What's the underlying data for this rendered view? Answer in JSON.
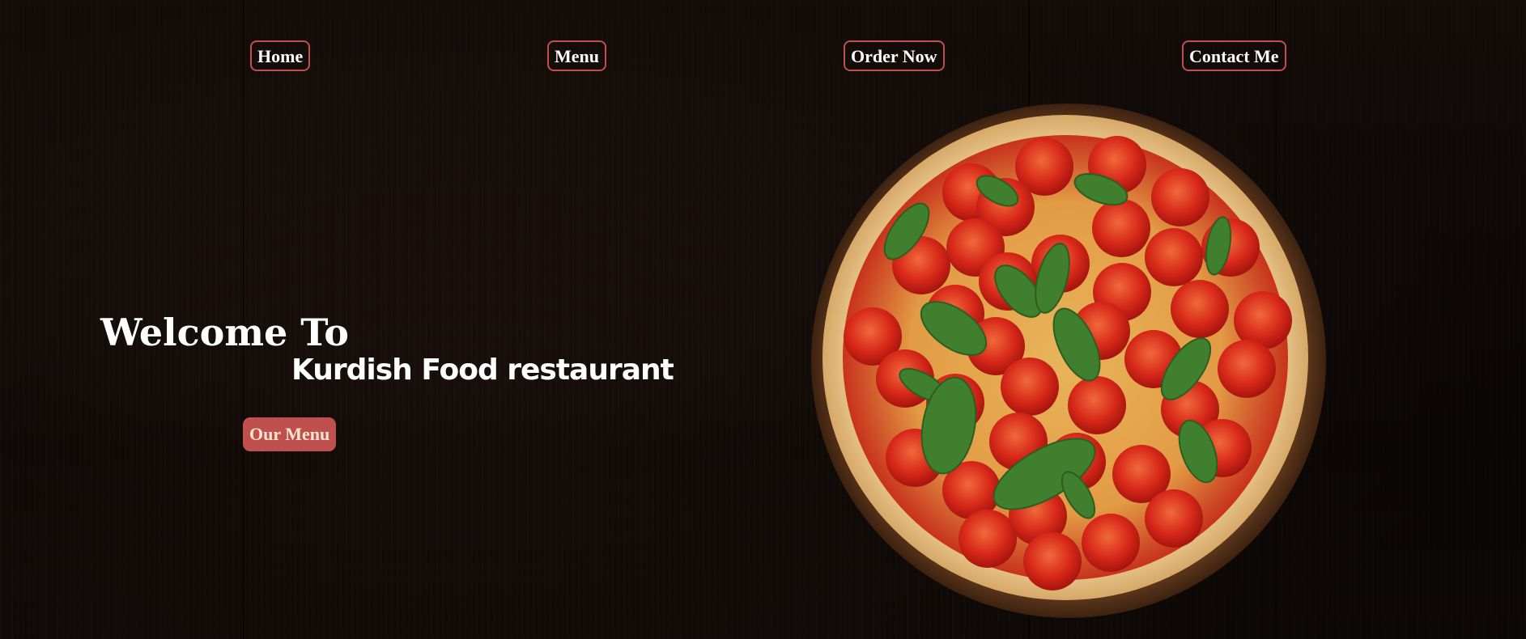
{
  "nav": {
    "items": [
      {
        "label": "Home"
      },
      {
        "label": "Menu"
      },
      {
        "label": "Order Now"
      },
      {
        "label": "Contact Me"
      }
    ]
  },
  "hero": {
    "welcome": "Welcome To",
    "restaurant_name": "Kurdish Food restaurant",
    "menu_button_label": "Our Menu"
  },
  "colors": {
    "accent": "#c0504d",
    "button_text": "#f7e6cf",
    "background": "#140c09"
  },
  "icons": {
    "hero_image": "pizza-image"
  }
}
